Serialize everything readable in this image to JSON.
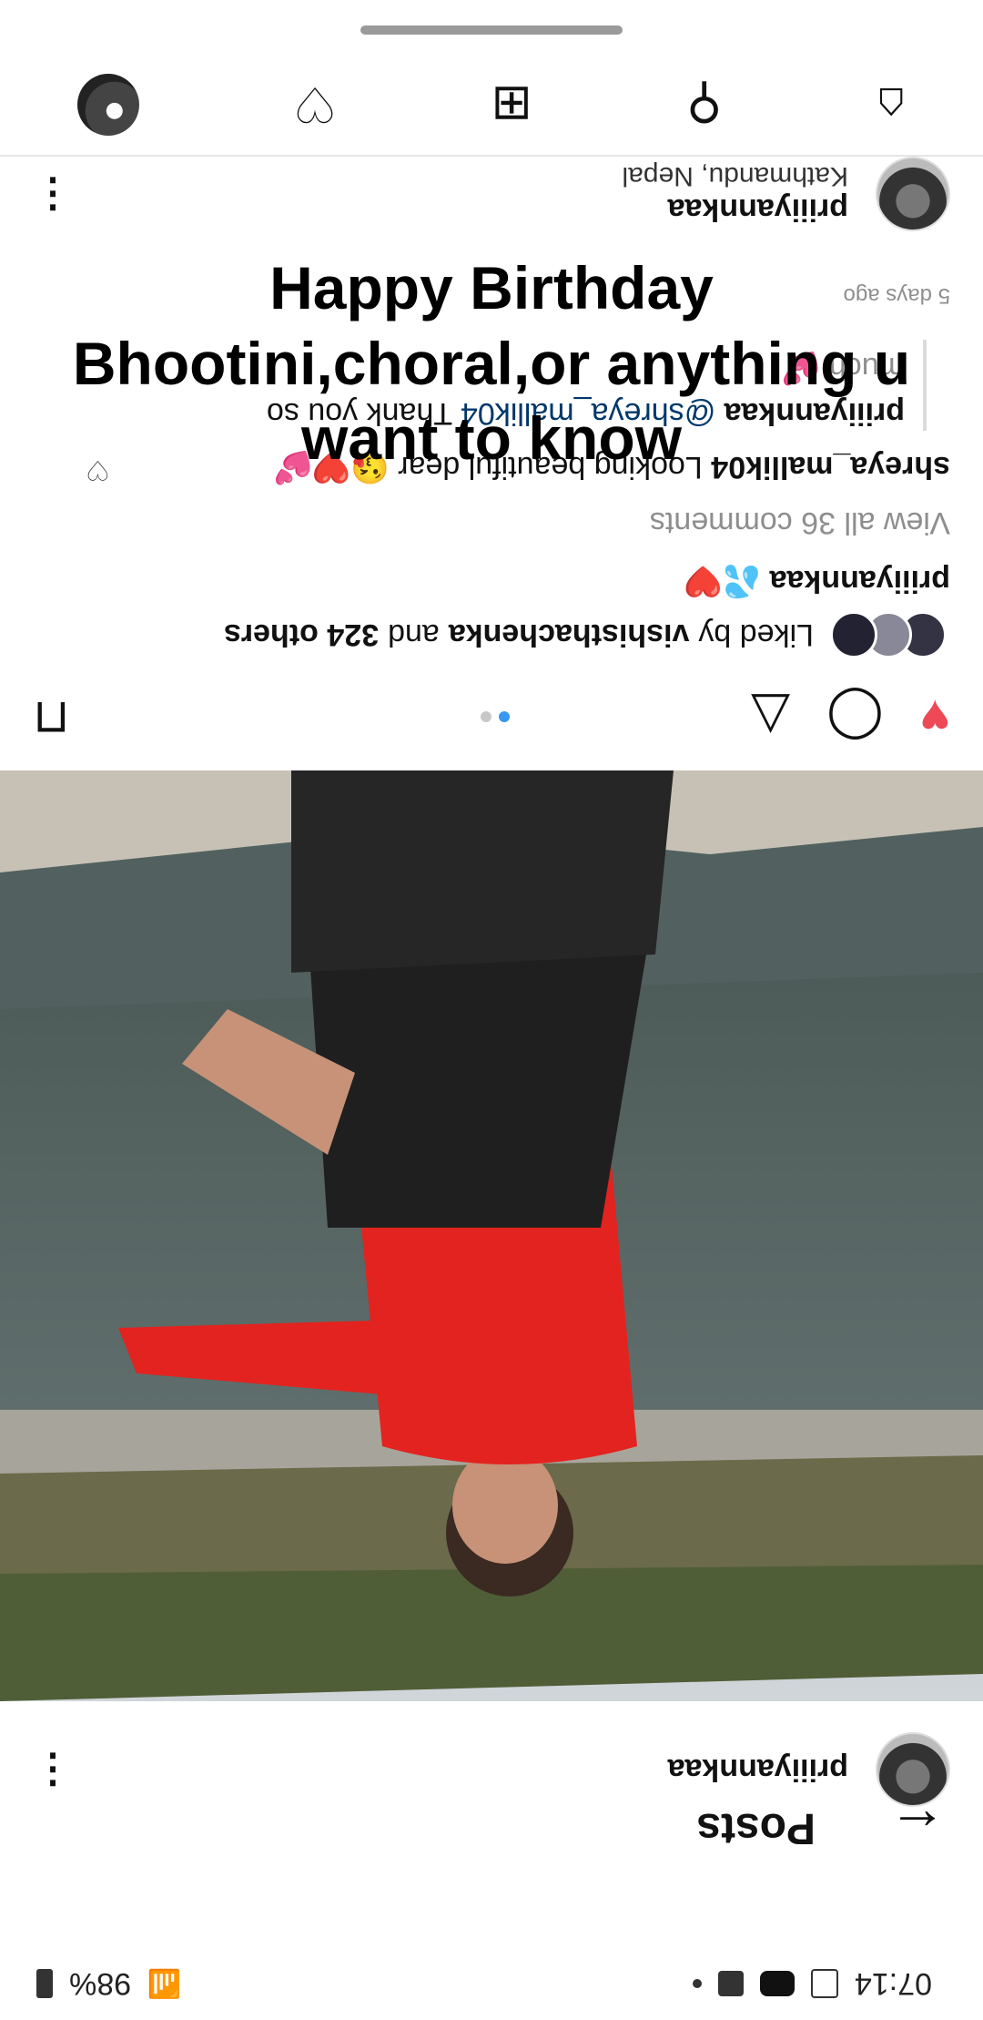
{
  "status_bar": {
    "time": "07:14",
    "battery": "98%"
  },
  "header": {
    "back_icon": "arrow-left-icon",
    "title": "Posts"
  },
  "post_header_2": {
    "username": "priiiyannkaa"
  },
  "post": {
    "username": "priiiyannkaa",
    "location": "Kathmandu, Nepal",
    "liked_by_prefix": "Liked by",
    "liked_by_user": "vishisthachenka",
    "liked_by_and": "and",
    "liked_by_others": "324 others",
    "caption_user": "priiiyannkaa",
    "caption_text": "💦❤️",
    "view_all": "View all 36 comments",
    "comment_user": "shreya_mallik04",
    "comment_text": "Looking beautiful dear 😘❤️💕",
    "reply_user": "priiiyannkaa",
    "reply_mention": "@shreya_mallik04",
    "reply_text": "Thank you so",
    "reply_line2": "much 💕",
    "time_ago": "5 days ago"
  },
  "overlay_text": {
    "line1": "Happy Birthday",
    "line2": "Bhootini,choral,or anything u want to know"
  },
  "colors": {
    "like_red": "#ed4956",
    "link_blue": "#00376b",
    "carousel_active": "#3897f0"
  }
}
